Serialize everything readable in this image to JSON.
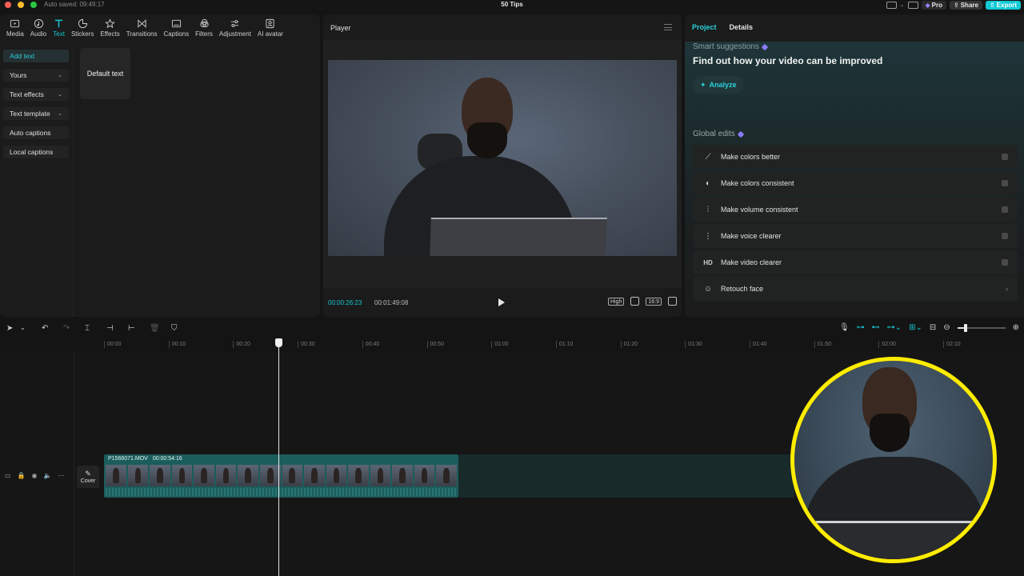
{
  "titlebar": {
    "autosaved": "Auto saved: 09:49:17",
    "title": "50 Tips",
    "pro_label": "Pro",
    "share_label": "Share",
    "export_label": "Export"
  },
  "toolbar": {
    "tools": [
      {
        "label": "Media",
        "icon": "media-icon"
      },
      {
        "label": "Audio",
        "icon": "audio-icon"
      },
      {
        "label": "Text",
        "icon": "text-icon"
      },
      {
        "label": "Stickers",
        "icon": "sticker-icon"
      },
      {
        "label": "Effects",
        "icon": "effects-icon"
      },
      {
        "label": "Transitions",
        "icon": "transitions-icon"
      },
      {
        "label": "Captions",
        "icon": "captions-icon"
      },
      {
        "label": "Filters",
        "icon": "filters-icon"
      },
      {
        "label": "Adjustment",
        "icon": "adjustment-icon"
      },
      {
        "label": "AI avatar",
        "icon": "avatar-icon"
      }
    ],
    "active": "Text"
  },
  "sidenav": {
    "items": [
      {
        "label": "Add text",
        "has_chevron": false
      },
      {
        "label": "Yours",
        "has_chevron": true
      },
      {
        "label": "Text effects",
        "has_chevron": true
      },
      {
        "label": "Text template",
        "has_chevron": true
      },
      {
        "label": "Auto captions",
        "has_chevron": false
      },
      {
        "label": "Local captions",
        "has_chevron": false
      }
    ]
  },
  "content": {
    "default_text": "Default text"
  },
  "player": {
    "header": "Player",
    "current_time": "00:00:26:23",
    "total_time": "00:01:49:08",
    "quality": "High",
    "ratio": "16:9"
  },
  "right_panel": {
    "tabs": [
      "Project",
      "Details"
    ],
    "active_tab": "Project",
    "suggestions_title": "Smart suggestions",
    "suggestions_headline": "Find out how your video can be improved",
    "analyze_label": "Analyze",
    "global_edits_title": "Global edits",
    "global_edits": [
      {
        "label": "Make colors better",
        "icon": "magic-wand-icon"
      },
      {
        "label": "Make colors consistent",
        "icon": "color-match-icon"
      },
      {
        "label": "Make volume consistent",
        "icon": "sliders-icon"
      },
      {
        "label": "Make voice clearer",
        "icon": "waveform-icon"
      },
      {
        "label": "Make video clearer",
        "icon": "hd-icon"
      },
      {
        "label": "Retouch face",
        "icon": "face-icon"
      }
    ]
  },
  "timeline": {
    "ruler": [
      "00:00",
      "00:10",
      "00:20",
      "00:30",
      "00:40",
      "00:50",
      "01:00",
      "01:10",
      "01:20",
      "01:30",
      "01:40",
      "01:50",
      "02:00",
      "02:10"
    ],
    "clip_name": "P1566071.MOV",
    "clip_duration": "00:00:54:16",
    "cover_label": "Cover"
  },
  "colors": {
    "accent": "#15c6d2",
    "clip": "#1b5d5c",
    "cam_border": "#ffec00"
  }
}
